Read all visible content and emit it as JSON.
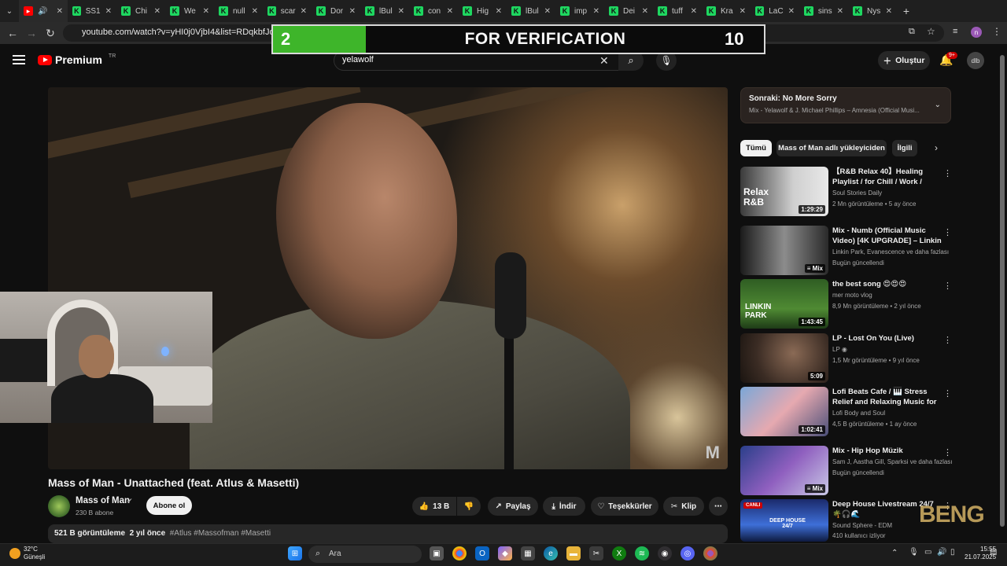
{
  "browser": {
    "tabs": [
      {
        "label": "",
        "active": true
      },
      {
        "label": "SS1"
      },
      {
        "label": "Chi"
      },
      {
        "label": "We"
      },
      {
        "label": "null"
      },
      {
        "label": "scar"
      },
      {
        "label": "Dor"
      },
      {
        "label": "lBul"
      },
      {
        "label": "con"
      },
      {
        "label": "Hig"
      },
      {
        "label": "lBul"
      },
      {
        "label": "imp"
      },
      {
        "label": "Dei"
      },
      {
        "label": "tuff"
      },
      {
        "label": "Kra"
      },
      {
        "label": "LaC"
      },
      {
        "label": "sins"
      },
      {
        "label": "Nys"
      }
    ],
    "url": "youtube.com/watch?v=yHI0j0VjbI4&list=RDqkbfJqaoIVo&"
  },
  "banner": {
    "count": "2",
    "title": "FOR VERIFICATION",
    "target": "10"
  },
  "header": {
    "logo_text": "Premium",
    "logo_region": "TR",
    "search_value": "yelawolf",
    "create_label": "Oluştur",
    "notif_badge": "9+",
    "avatar_text": "dlb"
  },
  "video": {
    "title": "Mass of Man - Unattached (feat. Atlus & Masetti)",
    "watermark": "M",
    "channel": "Mass of Man",
    "subs": "230 B abone",
    "subscribe_label": "Abone ol",
    "likes": "13 B",
    "share_label": "Paylaş",
    "download_label": "İndir",
    "thanks_label": "Teşekkürler",
    "clip_label": "Klip",
    "views": "521 B görüntüleme",
    "age": "2 yıl önce",
    "tags": "#Atlus #Massofman #Masetti"
  },
  "next": {
    "label": "Sonraki: No More Sorry",
    "sub": "Mix - Yelawolf & J. Michael Phillips – Amnesia (Official Musi..."
  },
  "chips": [
    "Tümü",
    "Mass of Man adlı yükleyiciden",
    "İlgili"
  ],
  "recs": [
    {
      "title": "【R&B Relax 40】Healing Playlist / for Chill / Work / Indi...",
      "channel": "Soul Stories Daily",
      "meta": "2 Mn görüntüleme • 5 ay önce",
      "dur": "1:29:29",
      "thumb_text": "Relax R&B"
    },
    {
      "title": "Mix - Numb (Official Music Video) [4K UPGRADE] – Linkin ...",
      "channel": "Linkin Park, Evanescence ve daha fazlası",
      "meta": "Bugün güncellendi",
      "dur": "Mix",
      "thumb_text": ""
    },
    {
      "title": "the best song 😍😍😍",
      "channel": "mer moto vlog",
      "meta": "8,9 Mn görüntüleme • 2 yıl önce",
      "dur": "1:43:45",
      "thumb_text": "LINKIN PARK"
    },
    {
      "title": "LP - Lost On You (Live)",
      "channel": "LP",
      "meta": "1,5 Mr görüntüleme • 9 yıl önce",
      "dur": "5:09",
      "thumb_text": ""
    },
    {
      "title": "Lofi Beats Cafe / 🎹 Stress Relief and Relaxing Music for ...",
      "channel": "Lofi Body and Soul",
      "meta": "4,5 B görüntüleme • 1 ay önce",
      "dur": "1:02:41",
      "thumb_text": ""
    },
    {
      "title": "Mix - Hip Hop Müzik",
      "channel": "Sam J, Aastha Gill, Sparksi ve daha fazlası",
      "meta": "Bugün güncellendi",
      "dur": "Mix",
      "thumb_text": ""
    },
    {
      "title": "Deep House Livestream 24/7 🌴🎧🌊",
      "channel": "Sound Sphere - EDM",
      "meta": "410 kullanıcı izliyor",
      "dur": "CANLI",
      "thumb_text": "DEEP HOUSE 24/7"
    }
  ],
  "taskbar": {
    "weather_temp": "32°C",
    "weather_desc": "Güneşli",
    "weather_badge": "6",
    "search_label": "Ara",
    "time": "15:55",
    "date": "21.07.2025"
  },
  "stream_overlay": "BENG"
}
